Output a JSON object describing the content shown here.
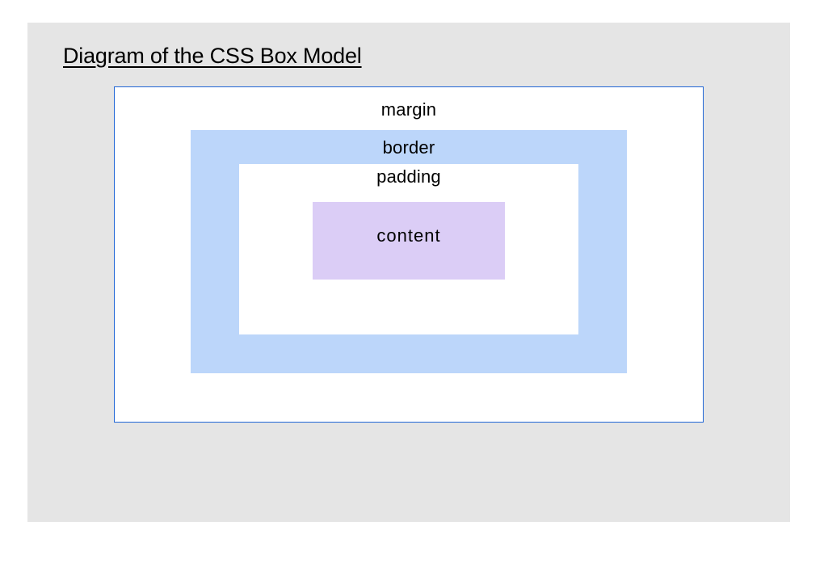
{
  "title": "Diagram of the CSS Box Model",
  "boxes": {
    "margin": {
      "label": "margin",
      "color": "#ffffff",
      "border_color": "#2066d6"
    },
    "border": {
      "label": "border",
      "color": "#bcd6fa"
    },
    "padding": {
      "label": "padding",
      "color": "#ffffff"
    },
    "content": {
      "label": "content",
      "color": "#dbcdf6"
    }
  }
}
